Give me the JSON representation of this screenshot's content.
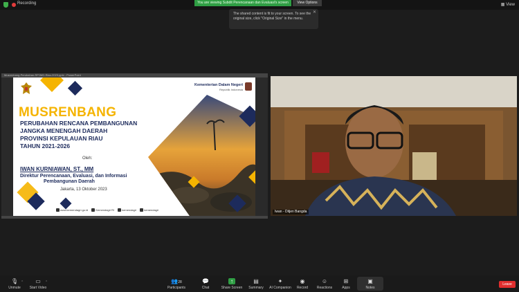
{
  "topbar": {
    "recording_label": "Recording",
    "viewing_banner": "You are viewing Subdit Perencanaan dan Evaluasi's screen",
    "view_options_label": "View Options",
    "view_label": "View"
  },
  "tooltip": {
    "text": "The shared content is fit to your screen. To see the original size, click \"Original Size\" in the menu.",
    "close_icon": "close-icon"
  },
  "share_window": {
    "title": "Musrenbang-Perubahan-RPJMD-Riau-2023.pptx - PowerPoint"
  },
  "slide": {
    "title": "MUSRENBANG",
    "subtitle_lines": [
      "PERUBAHAN RENCANA PEMBANGUNAN",
      "JANGKA MENENGAH DAERAH",
      "PROVINSI KEPULAUAN RIAU",
      "TAHUN 2021-2026"
    ],
    "by_label": "Oleh:",
    "presenter_name": "IWAN KURNIAWAN, ST., MM",
    "presenter_role_lines": [
      "Direktur Perencanaan, Evaluasi, dan Informasi",
      "Pembangunan Daerah"
    ],
    "date": "Jakarta, 13 Oktober 2023",
    "org_name": "Kementerian Dalam Negeri",
    "org_sub": "Republik Indonesia",
    "footer": {
      "website": "www.kemendagri.go.id",
      "facebook": "Kemendagri RI",
      "twitter": "kemendagri",
      "instagram": "kemendagri"
    },
    "colors": {
      "accent": "#f5b400",
      "navy": "#1d2b5c"
    }
  },
  "video": {
    "participant_name": "Iwan - Ditjen Bangda"
  },
  "toolbar": {
    "left": [
      {
        "label": "Unmute",
        "icon": "microphone-muted-icon"
      },
      {
        "label": "Start Video",
        "icon": "video-off-icon"
      }
    ],
    "participants_count": "28",
    "center": [
      {
        "label": "Participants",
        "icon": "participants-icon"
      },
      {
        "label": "Chat",
        "icon": "chat-icon"
      },
      {
        "label": "Share Screen",
        "icon": "share-screen-icon"
      },
      {
        "label": "Summary",
        "icon": "summary-icon"
      },
      {
        "label": "AI Companion",
        "icon": "sparkle-icon"
      },
      {
        "label": "Record",
        "icon": "record-icon"
      },
      {
        "label": "Reactions",
        "icon": "reactions-icon"
      },
      {
        "label": "Apps",
        "icon": "apps-icon"
      },
      {
        "label": "Notes",
        "icon": "notes-icon"
      }
    ],
    "leave_label": "Leave"
  }
}
